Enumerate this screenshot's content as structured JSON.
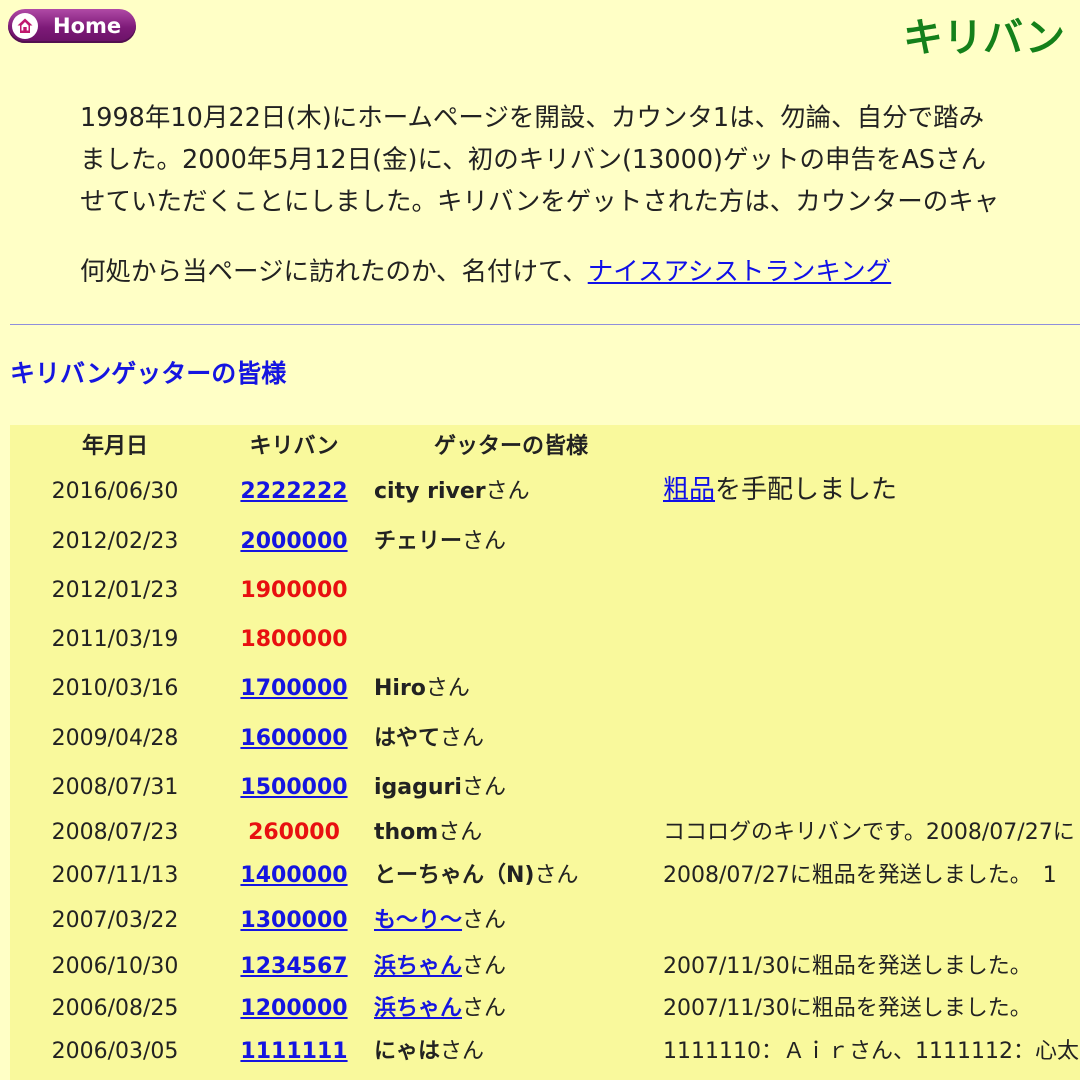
{
  "nav": {
    "home_label": "Home"
  },
  "page": {
    "title": "キリバン"
  },
  "intro": {
    "line1": "1998年10月22日(木)にホームページを開設、カウンタ1は、勿論、自分で踏み",
    "line2": "ました。2000年5月12日(金)に、初のキリバン(13000)ゲットの申告をASさん",
    "line3": "せていただくことにしました。キリバンをゲットされた方は、カウンターのキャ",
    "nice_prefix": "何処から当ページに訪れたのか、名付けて、",
    "nice_link": "ナイスアシストランキング"
  },
  "section": {
    "heading": "キリバンゲッターの皆様"
  },
  "table": {
    "headers": {
      "date": "年月日",
      "kiriban": "キリバン",
      "getter": "ゲッターの皆様"
    },
    "san_suffix": "さん",
    "rows": [
      {
        "date": "2016/06/30",
        "number": "2222222",
        "status": "link",
        "getter": "city river",
        "getter_link": false,
        "note_link": "粗品",
        "note": "を手配しました"
      },
      {
        "date": "2012/02/23",
        "number": "2000000",
        "status": "link",
        "getter": "チェリー",
        "getter_link": false,
        "note_link": "",
        "note": ""
      },
      {
        "date": "2012/01/23",
        "number": "1900000",
        "status": "unclaimed",
        "getter": "",
        "getter_link": false,
        "note_link": "",
        "note": ""
      },
      {
        "date": "2011/03/19",
        "number": "1800000",
        "status": "unclaimed",
        "getter": "",
        "getter_link": false,
        "note_link": "",
        "note": ""
      },
      {
        "date": "2010/03/16",
        "number": "1700000",
        "status": "link",
        "getter": "Hiro",
        "getter_link": false,
        "note_link": "",
        "note": ""
      },
      {
        "date": "2009/04/28",
        "number": "1600000",
        "status": "link",
        "getter": "はやて",
        "getter_link": false,
        "note_link": "",
        "note": ""
      },
      {
        "date": "2008/07/31",
        "number": "1500000",
        "status": "link",
        "getter": "igaguri",
        "getter_link": false,
        "note_link": "",
        "note": ""
      },
      {
        "date": "2008/07/23",
        "number": "260000",
        "status": "unclaimed",
        "getter": "thom",
        "getter_link": false,
        "note_link": "",
        "note": "ココログのキリバンです。2008/07/27に"
      },
      {
        "date": "2007/11/13",
        "number": "1400000",
        "status": "link",
        "getter": "とーちゃん（N)",
        "getter_link": false,
        "note_link": "",
        "note": "2008/07/27に粗品を発送しました。　1"
      },
      {
        "date": "2007/03/22",
        "number": "1300000",
        "status": "link",
        "getter": "も～り～",
        "getter_link": true,
        "note_link": "",
        "note": ""
      },
      {
        "date": "2006/10/30",
        "number": "1234567",
        "status": "link",
        "getter": "浜ちゃん",
        "getter_link": true,
        "note_link": "",
        "note": "2007/11/30に粗品を発送しました。"
      },
      {
        "date": "2006/08/25",
        "number": "1200000",
        "status": "link",
        "getter": "浜ちゃん",
        "getter_link": true,
        "note_link": "",
        "note": "2007/11/30に粗品を発送しました。"
      },
      {
        "date": "2006/03/05",
        "number": "1111111",
        "status": "link",
        "getter": "にゃは",
        "getter_link": false,
        "note_link": "",
        "note": "1111110：Ａｉｒさん、1111112：心太"
      }
    ]
  },
  "colors": {
    "background": "#ffffc6",
    "table_background": "#f9f99c",
    "title_green": "#14801a",
    "link_blue": "#1515e0",
    "unclaimed_red": "#e81010",
    "home_button_purple": "#7d1a78"
  },
  "icons": {
    "home": "house-icon"
  }
}
